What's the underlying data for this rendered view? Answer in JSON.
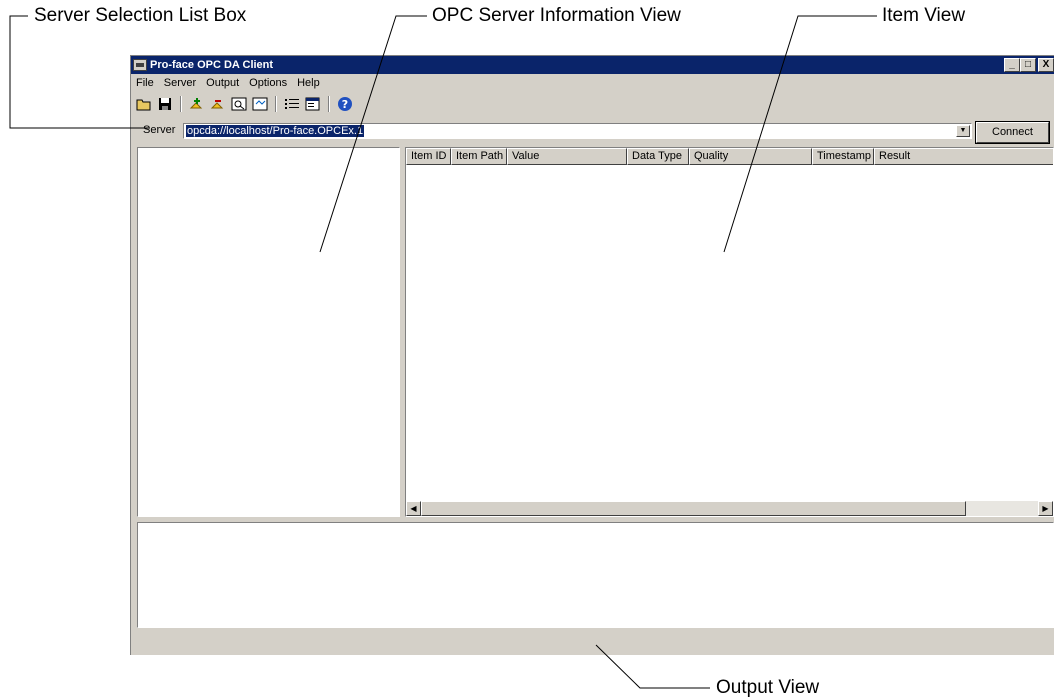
{
  "callouts": {
    "server_selection": "Server Selection List Box",
    "opc_server_info": "OPC Server Information View",
    "item_view": "Item View",
    "output_view": "Output View"
  },
  "window": {
    "title": "Pro-face OPC DA Client",
    "controls": [
      "_",
      "□",
      "X"
    ]
  },
  "menu": [
    "File",
    "Server",
    "Output",
    "Options",
    "Help"
  ],
  "toolbar": {
    "icons": [
      "open-icon",
      "save-icon",
      "add-server-icon",
      "remove-server-icon",
      "browse-icon",
      "refresh-icon",
      "list-icon",
      "properties-icon",
      "help-icon"
    ]
  },
  "server": {
    "label": "Server",
    "value": "opcda://localhost/Pro-face.OPCEx.1",
    "connect_label": "Connect"
  },
  "item_table": {
    "columns": [
      "Item ID",
      "Item Path",
      "Value",
      "Data Type",
      "Quality",
      "Timestamp",
      "Result"
    ],
    "rows": []
  },
  "colors": {
    "titlebar": "#0a246a",
    "window_face": "#d4d0c8",
    "selection": "#0a246a"
  }
}
